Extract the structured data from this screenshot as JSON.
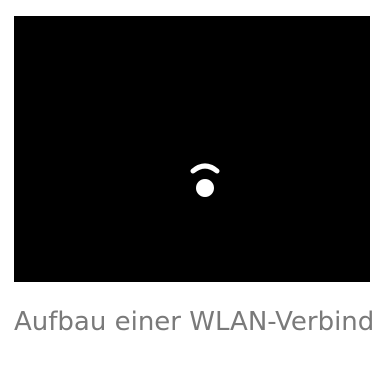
{
  "status": {
    "caption": "Aufbau einer WLAN-Verbind",
    "icon": "wifi-connecting-icon"
  },
  "colors": {
    "preview_background": "#000000",
    "icon": "#ffffff",
    "caption": "#7a7a7a",
    "page_background": "#ffffff"
  }
}
